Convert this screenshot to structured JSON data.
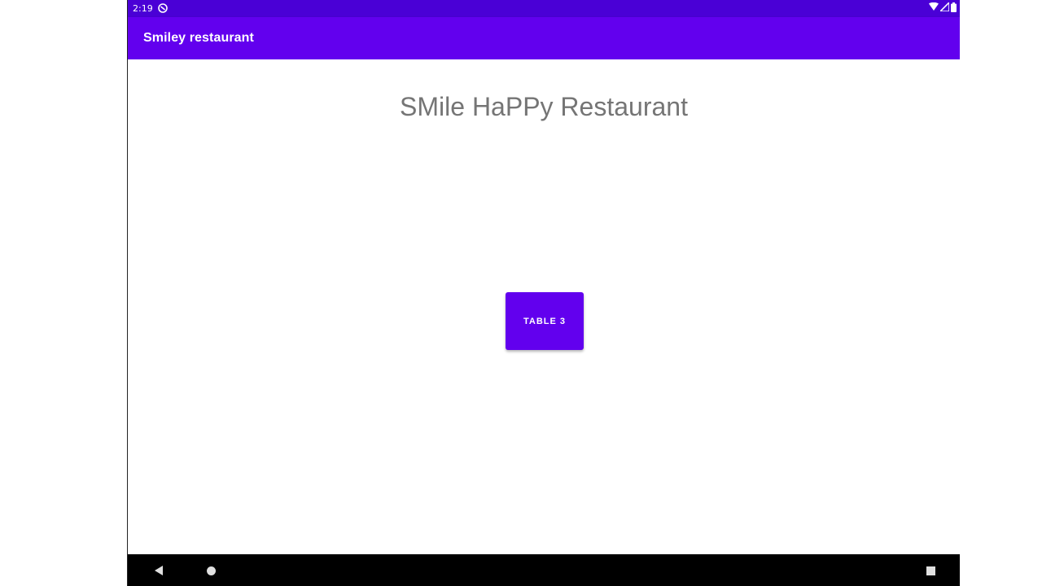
{
  "status_bar": {
    "time": "2:19",
    "icons": [
      "app-notification-icon",
      "wifi-icon",
      "cell-signal-icon",
      "battery-icon"
    ]
  },
  "app_bar": {
    "title": "Smiley restaurant"
  },
  "main": {
    "heading": "SMile HaPPy Restaurant",
    "table_button_label": "TABLE 3"
  },
  "nav_bar": {
    "icons": [
      "back-icon",
      "home-icon",
      "recents-icon"
    ]
  },
  "colors": {
    "primary": "#6200ee",
    "primary_dark": "#4a00d6",
    "heading_text": "#757575",
    "nav_bar": "#000000"
  }
}
